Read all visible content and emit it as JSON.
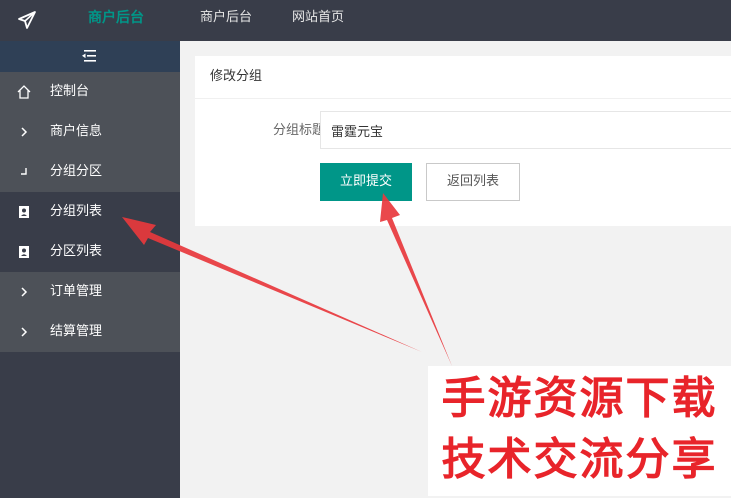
{
  "header": {
    "logo_text": "商户后台",
    "nav": [
      "商户后台",
      "网站首页"
    ]
  },
  "sidebar": {
    "items": [
      {
        "label": "控制台",
        "icon": "home-icon"
      },
      {
        "label": "商户信息",
        "icon": "chevron-right-icon"
      },
      {
        "label": "分组分区",
        "icon": "corner-icon"
      },
      {
        "label": "分组列表",
        "icon": "contact-book-icon",
        "active": true
      },
      {
        "label": "分区列表",
        "icon": "contact-book-icon"
      },
      {
        "label": "订单管理",
        "icon": "chevron-right-icon"
      },
      {
        "label": "结算管理",
        "icon": "chevron-right-icon"
      }
    ]
  },
  "main": {
    "card_title": "修改分组",
    "form": {
      "label": "分组标题",
      "value": "雷霆元宝"
    },
    "buttons": {
      "submit": "立即提交",
      "back": "返回列表"
    }
  },
  "watermark": {
    "line1": "手游资源下载",
    "line2": "技术交流分享"
  },
  "colors": {
    "topbar": "#393d49",
    "accent": "#009688",
    "arrow": "#e8383d"
  }
}
